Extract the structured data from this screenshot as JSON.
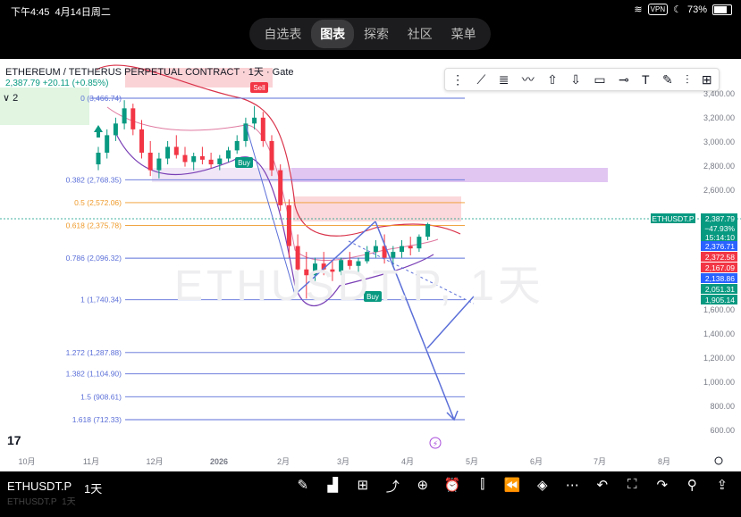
{
  "status": {
    "time": "下午4:45",
    "date": "4月14日周二",
    "vpn": "VPN",
    "battery": "73%"
  },
  "nav": {
    "tabs": [
      "自选表",
      "图表",
      "探索",
      "社区",
      "菜单"
    ],
    "active": 1
  },
  "chart": {
    "title": "ETHEREUM / TETHERUS PERPETUAL CONTRACT · 1天 · Gate",
    "price_line": "2,387.79  +20.11 (+0.85%)",
    "indicator_count": "2",
    "watermark": "ETHUSDT.P, 1天",
    "fib_levels": [
      {
        "label": "0 (3,466.74)",
        "price": 3466.74,
        "color": "#5b6fd8"
      },
      {
        "label": "0.382 (2,768.35)",
        "price": 2768.35,
        "color": "#5b6fd8"
      },
      {
        "label": "0.5 (2,572.06)",
        "price": 2572.06,
        "color": "#ef9a2a"
      },
      {
        "label": "0.618 (2,375.78)",
        "price": 2375.78,
        "color": "#ef9a2a"
      },
      {
        "label": "0.786 (2,096.32)",
        "price": 2096.32,
        "color": "#5b6fd8"
      },
      {
        "label": "1 (1,740.34)",
        "price": 1740.34,
        "color": "#5b6fd8"
      },
      {
        "label": "1.272 (1,287.88)",
        "price": 1287.88,
        "color": "#5b6fd8"
      },
      {
        "label": "1.382 (1,104.90)",
        "price": 1104.9,
        "color": "#5b6fd8"
      },
      {
        "label": "1.5 (908.61)",
        "price": 908.61,
        "color": "#5b6fd8"
      },
      {
        "label": "1.618 (712.33)",
        "price": 712.33,
        "color": "#5b6fd8"
      }
    ],
    "y_ticks": [
      "3,400.00",
      "3,200.00",
      "3,000.00",
      "2,800.00",
      "2,600.00",
      "1,600.00",
      "1,400.00",
      "1,200.00",
      "1,000.00",
      "800.00",
      "600.00"
    ],
    "x_ticks": [
      "10月",
      "11月",
      "12月",
      "2026",
      "2月",
      "3月",
      "4月",
      "5月",
      "6月",
      "7月",
      "8月"
    ],
    "symbol_tag": "ETHUSDT.P",
    "price_badges": [
      {
        "text": "2,387.79",
        "color": "#089981"
      },
      {
        "text": "−47.93%",
        "color": "#089981"
      },
      {
        "text": "15:14:10",
        "color": "#089981"
      },
      {
        "text": "2,376.71",
        "color": "#2962ff"
      },
      {
        "text": "2,372.58",
        "color": "#f23645"
      },
      {
        "text": "2,167.09",
        "color": "#f23645"
      },
      {
        "text": "2,138.86",
        "color": "#2962ff"
      },
      {
        "text": "2,051.31",
        "color": "#089981"
      },
      {
        "text": "1,905.14",
        "color": "#089981"
      }
    ],
    "signals": {
      "sell": "Sell",
      "buy": "Buy"
    }
  },
  "bottom": {
    "symbol": "ETHUSDT.P",
    "timeframe": "1天",
    "ghost_symbol": "ETHUSDT.P",
    "ghost_tf": "1天"
  }
}
